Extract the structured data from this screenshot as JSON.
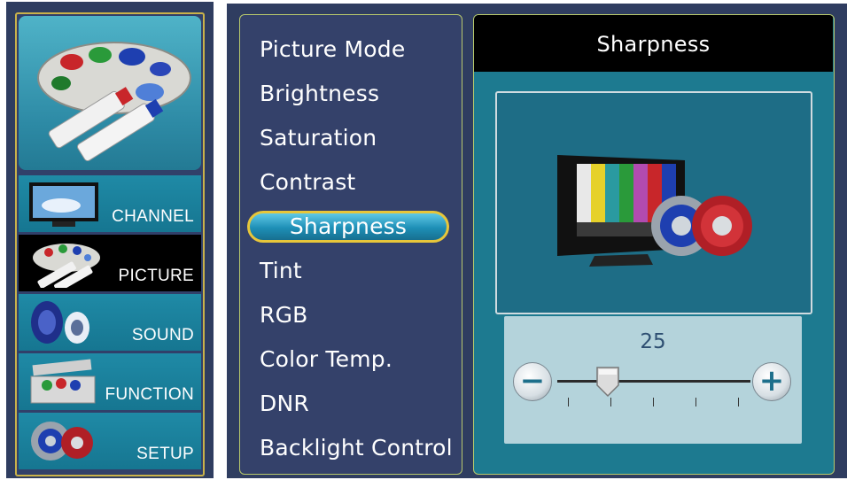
{
  "sidebar": {
    "categories": [
      {
        "label": "CHANNEL",
        "icon": "tv-icon",
        "active": false
      },
      {
        "label": "PICTURE",
        "icon": "palette-icon",
        "active": true
      },
      {
        "label": "SOUND",
        "icon": "speaker-icon",
        "active": false
      },
      {
        "label": "FUNCTION",
        "icon": "toolbox-icon",
        "active": false
      },
      {
        "label": "SETUP",
        "icon": "gears-icon",
        "active": false
      }
    ]
  },
  "menu": {
    "items": [
      "Picture Mode",
      "Brightness",
      "Saturation",
      "Contrast",
      "Sharpness",
      "Tint",
      "RGB",
      "Color Temp.",
      "DNR",
      "Backlight Control"
    ],
    "selected_index": 4
  },
  "detail": {
    "title": "Sharpness",
    "value": "25",
    "level": 0.25,
    "minus_label": "−",
    "plus_label": "+"
  },
  "colors": {
    "panel_bg": "#2f3d60",
    "accent_gold": "#e7c63a",
    "highlight_cyan": "#1e8fb6",
    "slider_bg": "#b4d3db"
  }
}
